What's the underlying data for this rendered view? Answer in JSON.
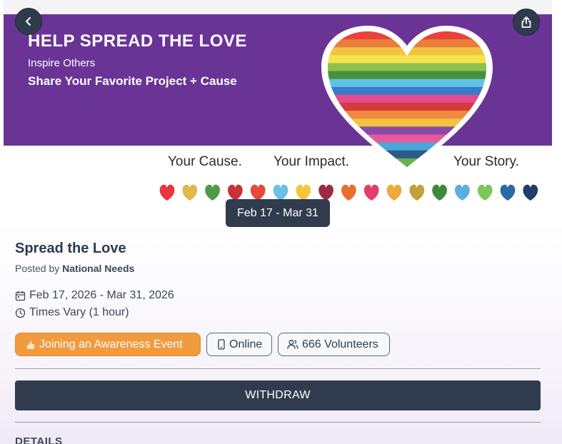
{
  "hero": {
    "title": "HELP SPREAD THE LOVE",
    "subtitle1": "Inspire Others",
    "subtitle2": "Share Your Favorite Project + Cause",
    "tag1": "Your Cause.",
    "tag2": "Your Impact.",
    "tag3": "Your Story.",
    "heart_colors": [
      "#e8423b",
      "#e97d3a",
      "#f0c43f",
      "#f6e34a",
      "#8cc152",
      "#4a8f3c",
      "#5ec3e8",
      "#3a7bc8",
      "#e54a8c",
      "#d43b3b",
      "#f08a3c",
      "#f4c43f",
      "#8a4aa8",
      "#e85a9a",
      "#4aa8d8",
      "#2d5a8a",
      "#6ab04c",
      "#2f4f7a"
    ],
    "mini_heart_colors": [
      "#e8363b",
      "#dfb94a",
      "#4f9a45",
      "#c8303a",
      "#e84a3a",
      "#6cc0e8",
      "#f2c83a",
      "#9c2a42",
      "#e8702e",
      "#e23e6e",
      "#f0a83a",
      "#c4a03a",
      "#3f8a3a",
      "#5aaee0",
      "#7cc85a",
      "#2b6aa3",
      "#1f3f66"
    ]
  },
  "nav": {
    "back_icon": "chevron-left-icon",
    "share_icon": "share-icon"
  },
  "date_chip": "Feb 17 - Mar 31",
  "event": {
    "title": "Spread the Love",
    "posted_by_prefix": "Posted by",
    "posted_by": "National Needs",
    "date_range": "Feb 17, 2026 - Mar 31, 2026",
    "time": "Times Vary (1 hour)"
  },
  "pills": {
    "joining": "Joining an Awareness Event",
    "online": "Online",
    "volunteers_count": "666",
    "volunteers_label": "Volunteers"
  },
  "actions": {
    "withdraw": "WITHDRAW"
  },
  "sections": {
    "details": "DETAILS"
  },
  "colors": {
    "primary": "#303c4e",
    "accent": "#f19a3e",
    "hero_purple": "#6a3496"
  }
}
